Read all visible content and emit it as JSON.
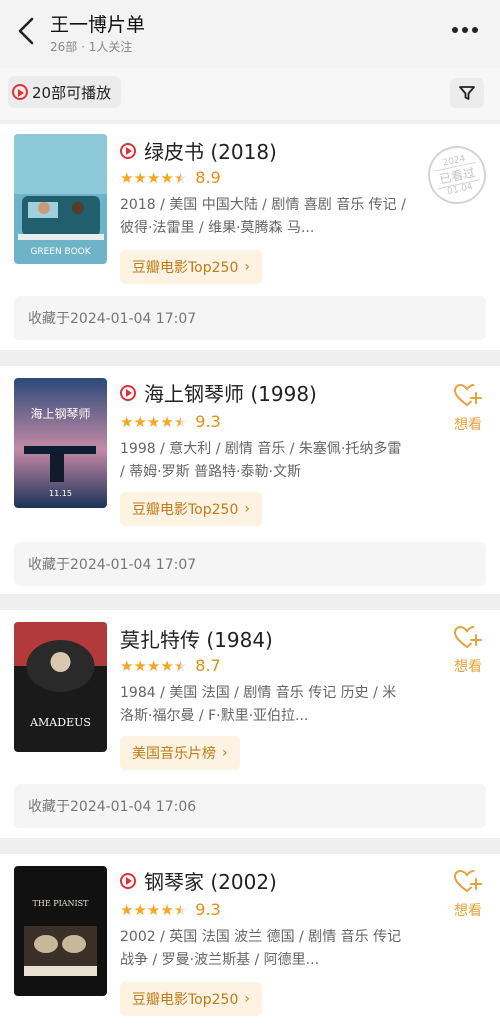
{
  "header": {
    "title": "王一博片单",
    "subtitle": "26部 · 1人关注"
  },
  "filter": {
    "playable_label": "20部可播放"
  },
  "movies": [
    {
      "title": "绿皮书 (2018)",
      "score": "8.9",
      "meta": "2018 / 美国 中国大陆 / 剧情 喜剧 音乐 传记 / 彼得·法雷里 / 维果·莫腾森 马...",
      "tag": "豆瓣电影Top250",
      "saved": "收藏于2024-01-04 17:07",
      "playable": true,
      "stamp": {
        "year": "2024",
        "label": "已看过",
        "date": "01.04"
      },
      "poster_title": "GREEN BOOK"
    },
    {
      "title": "海上钢琴师 (1998)",
      "score": "9.3",
      "meta": "1998 / 意大利 / 剧情 音乐 / 朱塞佩·托纳多雷 / 蒂姆·罗斯 普路特·泰勒·文斯",
      "tag": "豆瓣电影Top250",
      "saved": "收藏于2024-01-04 17:07",
      "playable": true,
      "want": "想看",
      "poster_title": "海上钢琴师",
      "poster_date": "11.15"
    },
    {
      "title": "莫扎特传 (1984)",
      "score": "8.7",
      "meta": "1984 / 美国 法国 / 剧情 音乐 传记 历史 / 米洛斯·福尔曼 / F·默里·亚伯拉...",
      "tag": "美国音乐片榜",
      "saved": "收藏于2024-01-04 17:06",
      "playable": false,
      "want": "想看",
      "poster_title": "AMADEUS"
    },
    {
      "title": "钢琴家 (2002)",
      "score": "9.3",
      "meta": "2002 / 英国 法国 波兰 德国 / 剧情 音乐 传记 战争 / 罗曼·波兰斯基 / 阿德里...",
      "tag": "豆瓣电影Top250",
      "playable": true,
      "want": "想看",
      "poster_title": "THE PIANIST"
    }
  ],
  "colors": {
    "accent_orange": "#e8a23b",
    "play_red": "#e0313a",
    "tag_bg": "#fdf3e3",
    "tag_text": "#c07a18"
  }
}
